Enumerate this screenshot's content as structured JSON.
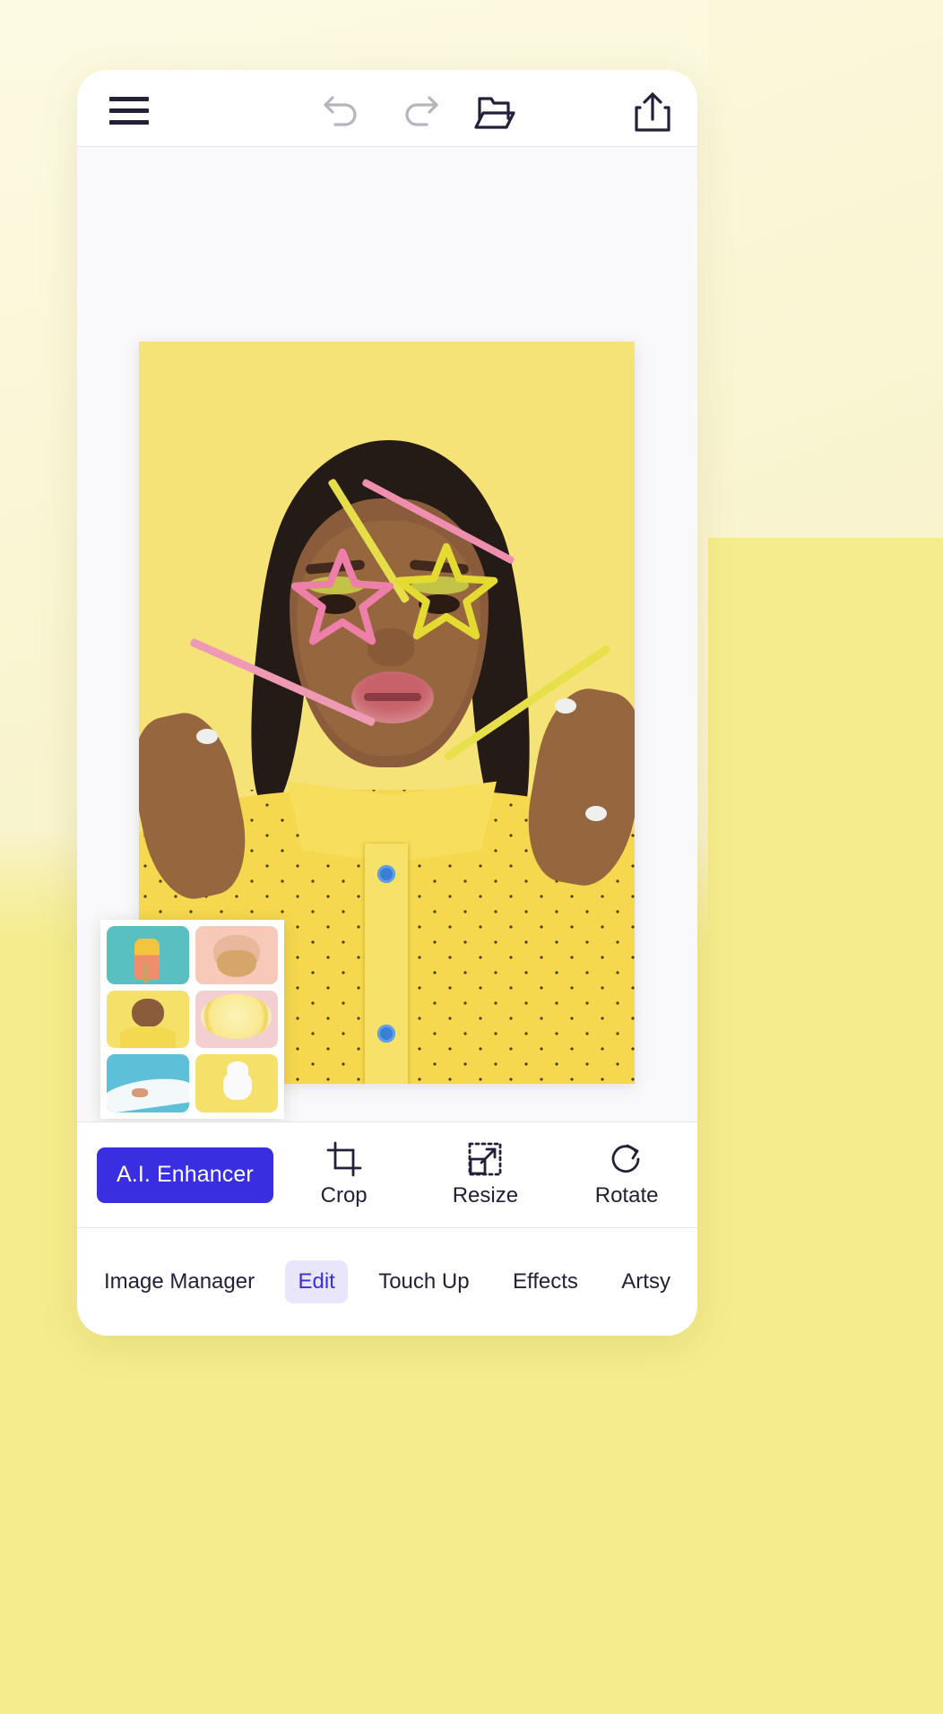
{
  "app": {
    "background_top_color": "#fbf8dd",
    "background_bottom_color": "#f5ec8c",
    "accent_color": "#3a2fe0",
    "accent_soft_color": "#e9e6fb",
    "canvas_color": "#f9f9fb"
  },
  "topbar": {
    "menu_label": "Menu",
    "undo_label": "Undo",
    "undo_enabled": "false",
    "redo_label": "Redo",
    "redo_enabled": "false",
    "open_label": "Open",
    "share_label": "Share"
  },
  "canvas": {
    "photo_alt": "Woman with yellow eyeshadow holding pink and yellow star-shaped straws over her eyes on a yellow background",
    "photo_background_color": "#f6e377",
    "thumbnails": [
      {
        "name": "popsicle-thumbnail",
        "alt": "Yellow and pink popsicle held on a teal background",
        "color": "#59bfc0"
      },
      {
        "name": "bearded-man-thumbnail",
        "alt": "Bearded man holding a flower on a pink background",
        "color": "#f6c9b9"
      },
      {
        "name": "woman-straws-thumbnail",
        "alt": "Woman with star straws on a yellow background",
        "color": "#f5e06a"
      },
      {
        "name": "lemon-thumbnail",
        "alt": "Lemon slice on a pink background",
        "color": "#f3cfd2"
      },
      {
        "name": "surfer-thumbnail",
        "alt": "Aerial view of a surfer riding a wave",
        "color": "#5ec0d8"
      },
      {
        "name": "rabbit-thumbnail",
        "alt": "White rabbit on a yellow background",
        "color": "#f5e06a"
      }
    ]
  },
  "toolrow": {
    "ai_enhancer_label": "A.I. Enhancer",
    "tools": [
      {
        "name": "crop",
        "label": "Crop",
        "icon": "crop-icon"
      },
      {
        "name": "resize",
        "label": "Resize",
        "icon": "resize-icon"
      },
      {
        "name": "rotate",
        "label": "Rotate",
        "icon": "rotate-icon"
      }
    ]
  },
  "tabs": {
    "active": "Edit",
    "items": [
      {
        "label": "Image Manager",
        "active": false
      },
      {
        "label": "Edit",
        "active": true
      },
      {
        "label": "Touch Up",
        "active": false
      },
      {
        "label": "Effects",
        "active": false
      },
      {
        "label": "Artsy",
        "active": false
      }
    ]
  }
}
